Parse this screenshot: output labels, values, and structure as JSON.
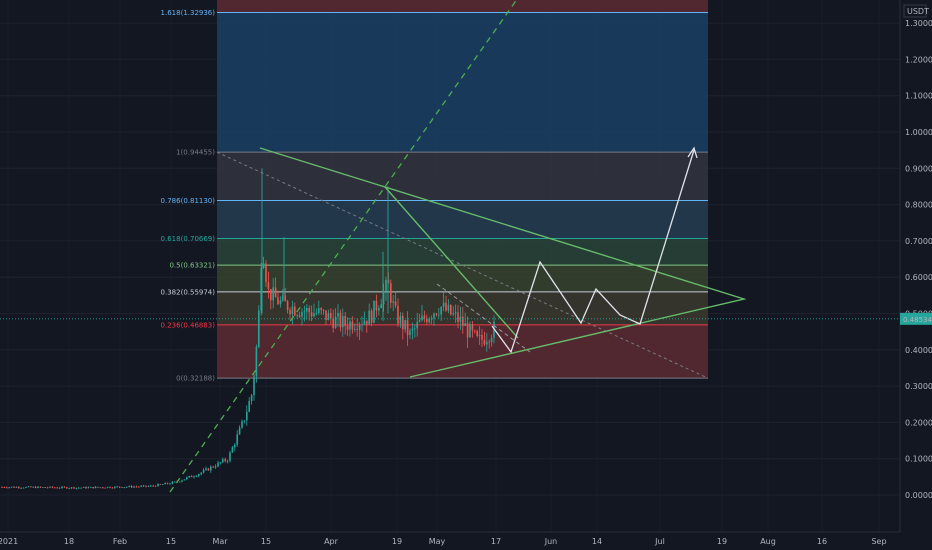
{
  "chart_data": {
    "type": "candlestick",
    "axis_unit": "USDT",
    "current_price": "0.48534",
    "y_ticks": [
      "1.30000",
      "1.20000",
      "1.10000",
      "1.00000",
      "0.90000",
      "0.80000",
      "0.70000",
      "0.60000",
      "0.50000",
      "0.40000",
      "0.30000",
      "0.20000",
      "0.10000",
      "0.00000"
    ],
    "y_tick_values": [
      1.3,
      1.2,
      1.1,
      1.0,
      0.9,
      0.8,
      0.7,
      0.6,
      0.5,
      0.4,
      0.3,
      0.2,
      0.1,
      0.0
    ],
    "x_ticks": [
      "2021",
      "18",
      "Feb",
      "15",
      "Mar",
      "15",
      "Apr",
      "19",
      "May",
      "17",
      "Jun",
      "14",
      "Jul",
      "19",
      "Aug",
      "16",
      "Sep"
    ],
    "fib_levels": [
      {
        "label": "0(0.32188)",
        "value": 0.32188,
        "color": "#787b86",
        "fill": "#5d2a33"
      },
      {
        "label": "0.236(0.46883)",
        "value": 0.46883,
        "color": "#f23645",
        "fill": "#3b3a2e"
      },
      {
        "label": "0.382(0.55974)",
        "value": 0.55974,
        "color": "#c8ccd6",
        "fill": "#37432f"
      },
      {
        "label": "0.5(0.63321)",
        "value": 0.63321,
        "color": "#81c784",
        "fill": "#294437"
      },
      {
        "label": "0.618(0.70669)",
        "value": 0.70669,
        "color": "#26a69a",
        "fill": "#263d51"
      },
      {
        "label": "0.786(0.81130)",
        "value": 0.8113,
        "color": "#64b5f6",
        "fill": "#33343f"
      },
      {
        "label": "1(0.94455)",
        "value": 0.94455,
        "color": "#787b86",
        "fill": "#1b3f64"
      },
      {
        "label": "1.618(1.32936)",
        "value": 1.32936,
        "color": "#64b5f6",
        "fill": "#5d2a33"
      }
    ],
    "colors": {
      "background": "#131722",
      "candle_up": "#26a69a",
      "candle_down": "#ef5350",
      "triangle": "#66bb6a",
      "trend_dashed": "#4caf50",
      "projection": "#e0e3eb",
      "current_price_line": "#26a69a"
    }
  }
}
